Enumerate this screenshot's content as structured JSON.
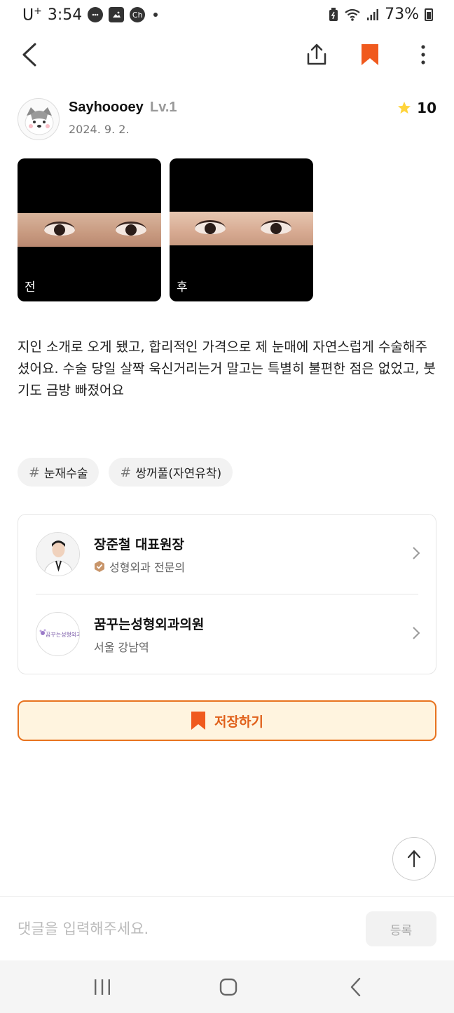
{
  "status_bar": {
    "carrier": "U",
    "carrier_sup": "+",
    "time": "3:54",
    "battery": "73%",
    "icons": [
      "chat-icon",
      "image-icon",
      "ch-icon",
      "dot-icon",
      "battery-saver-icon",
      "wifi-icon",
      "signal-icon",
      "battery-icon"
    ]
  },
  "nav": {
    "icons": [
      "back-icon",
      "share-icon",
      "bookmark-icon",
      "more-icon"
    ],
    "bookmark_color": "#F05A1E"
  },
  "author": {
    "name": "Sayhoooey",
    "level": "Lv.1",
    "date": "2024. 9. 2.",
    "rating": "10",
    "rating_icon": "star-icon"
  },
  "photos": [
    {
      "label": "전"
    },
    {
      "label": "후"
    }
  ],
  "review": {
    "text": "지인 소개로 오게 됐고, 합리적인 가격으로 제 눈매에 자연스럽게 수술해주셨어요. 수술 당일 살짝 욱신거리는거 말고는 특별히 불편한 점은 없었고, 붓기도 금방 빠졌어요"
  },
  "tags": [
    {
      "hash": "#",
      "label": "눈재수술"
    },
    {
      "hash": "#",
      "label": "쌍꺼풀(자연유착)"
    }
  ],
  "doctor": {
    "name": "장준철 대표원장",
    "specialty": "성형외과 전문의",
    "badge_icon": "certified-badge-icon"
  },
  "clinic": {
    "name": "꿈꾸는성형외과의원",
    "location": "서울 강남역",
    "logo_text": "꿈꾸는성형외과"
  },
  "save_button": {
    "label": "저장하기",
    "accent": "#E8731F"
  },
  "comment": {
    "placeholder": "댓글을 입력해주세요.",
    "submit_label": "등록"
  },
  "system_nav": {
    "icons": [
      "recent-apps-icon",
      "home-icon",
      "back-icon"
    ]
  }
}
